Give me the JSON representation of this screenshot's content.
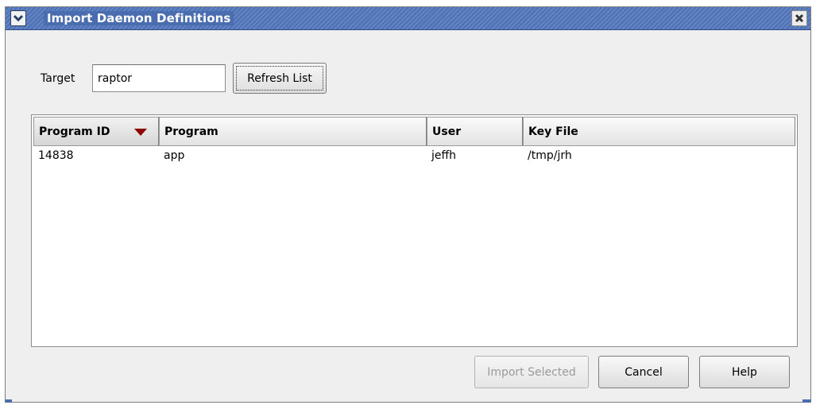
{
  "window": {
    "title": "Import Daemon Definitions"
  },
  "target": {
    "label": "Target",
    "value": "raptor"
  },
  "refresh_button": {
    "label": "Refresh List"
  },
  "table": {
    "columns": [
      "Program ID",
      "Program",
      "User",
      "Key File"
    ],
    "sort_column": "Program ID",
    "sort_direction": "descending",
    "rows": [
      {
        "program_id": "14838",
        "program": "app",
        "user": "jeffh",
        "key_file": "/tmp/jrh"
      }
    ]
  },
  "buttons": {
    "import_selected": "Import Selected",
    "cancel": "Cancel",
    "help": "Help"
  },
  "colors": {
    "titlebar": "#4a6db0",
    "sort_arrow": "#8b0000",
    "disabled_text": "#9a9a9a"
  },
  "icons": {
    "window_menu": "chevron-down-icon",
    "close": "close-icon",
    "sort": "sort-descending-icon"
  }
}
